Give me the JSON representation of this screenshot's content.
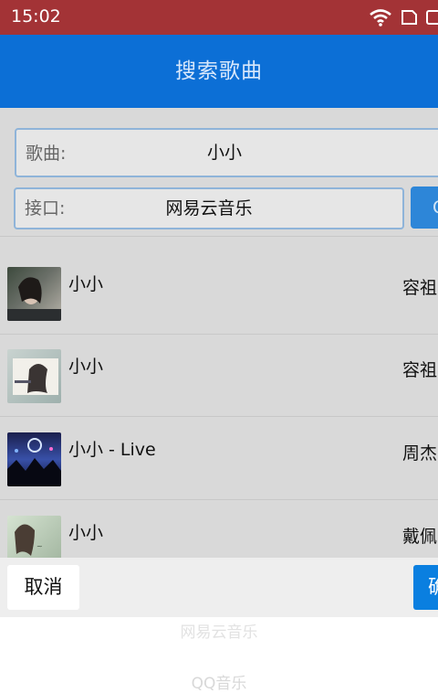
{
  "status_bar": {
    "time": "15:02"
  },
  "app_bar": {
    "title": "搜索歌曲"
  },
  "search": {
    "song_label": "歌曲:",
    "song_value": "小小",
    "interface_label": "接口:",
    "interface_value": "网易云音乐",
    "search_button_label": "Q"
  },
  "results": [
    {
      "title": "小小",
      "artist": "容祖"
    },
    {
      "title": "小小",
      "artist": "容祖"
    },
    {
      "title": "小小 - Live",
      "artist": "周杰"
    },
    {
      "title": "小小",
      "artist": "戴佩"
    }
  ],
  "bottom_bar": {
    "cancel_label": "取消",
    "confirm_label": "确"
  },
  "background_options": [
    "网易云音乐",
    "QQ音乐"
  ]
}
